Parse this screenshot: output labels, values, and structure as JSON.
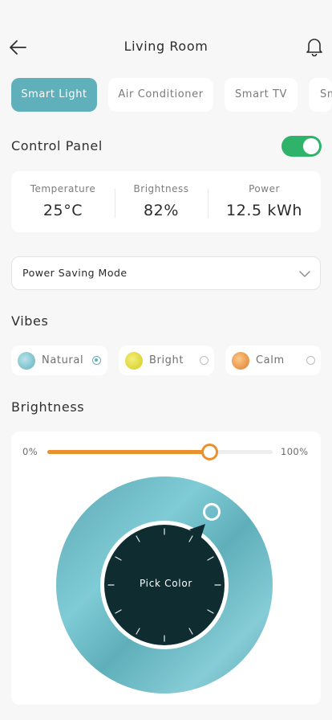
{
  "header": {
    "title": "Living Room",
    "back_icon": "arrow-left-icon",
    "notification_icon": "bell-icon"
  },
  "tabs": [
    {
      "label": "Smart Light",
      "active": true
    },
    {
      "label": "Air Conditioner",
      "active": false
    },
    {
      "label": "Smart TV",
      "active": false
    },
    {
      "label": "Sm",
      "active": false
    }
  ],
  "control_panel": {
    "title": "Control Panel",
    "power_on": true,
    "stats": [
      {
        "label": "Temperature",
        "value": "25°C"
      },
      {
        "label": "Brightness",
        "value": "82%"
      },
      {
        "label": "Power",
        "value": "12.5 kWh"
      }
    ]
  },
  "mode_select": {
    "value": "Power Saving Mode"
  },
  "vibes": {
    "title": "Vibes",
    "items": [
      {
        "label": "Natural",
        "selected": true
      },
      {
        "label": "Bright",
        "selected": false
      },
      {
        "label": "Calm",
        "selected": false
      }
    ]
  },
  "brightness": {
    "title": "Brightness",
    "min_label": "0%",
    "max_label": "100%",
    "level": 0.72,
    "pick_label": "Pick Color"
  },
  "colors": {
    "accent": "#5fb0bb",
    "toggle_on": "#2fb36b",
    "slider": "#e8912e",
    "dial": "#0f2c31"
  }
}
